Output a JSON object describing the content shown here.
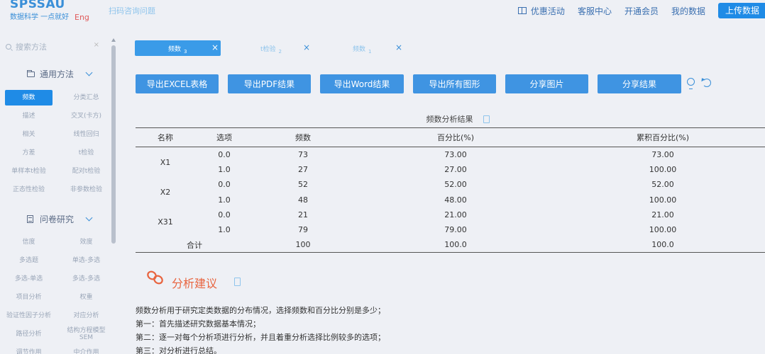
{
  "header": {
    "logo": "SPSSAU",
    "slogan": "数据科学 一点就好",
    "lang": "Eng",
    "scan_link": "扫码咨询问题",
    "nav": [
      "优惠活动",
      "客服中心",
      "开通会员",
      "我的数据"
    ],
    "upload_label": "上传数据"
  },
  "sidebar": {
    "search_placeholder": "搜索方法",
    "search_clear": "×",
    "group1": {
      "title": "通用方法",
      "items": [
        "频数",
        "分类汇总",
        "描述",
        "交叉(卡方)",
        "相关",
        "线性回归",
        "方差",
        "t检验",
        "单样本t检验",
        "配对t检验",
        "正态性检验",
        "非参数检验"
      ],
      "active": "频数"
    },
    "group2": {
      "title": "问卷研究",
      "items": [
        "信度",
        "效度",
        "多选题",
        "单选-多选",
        "多选-单选",
        "多选-多选",
        "项目分析",
        "权重",
        "验证性因子分析",
        "对应分析",
        "路径分析",
        "结构方程模型SEM",
        "调节作用",
        "中介作用"
      ]
    }
  },
  "tabs": [
    {
      "label": "频数",
      "sub": "3",
      "close": "×",
      "active": true
    },
    {
      "label": "t检验",
      "sub": "2",
      "close": "×",
      "active": false
    },
    {
      "label": "频数",
      "sub": "1",
      "close": "×",
      "active": false
    }
  ],
  "toolbar": {
    "buttons": [
      "导出EXCEL表格",
      "导出PDF结果",
      "导出Word结果",
      "导出所有图形",
      "分享图片",
      "分享结果"
    ]
  },
  "result_table": {
    "title": "频数分析结果",
    "headers": [
      "名称",
      "选项",
      "频数",
      "百分比(%)",
      "累积百分比(%)"
    ],
    "rows": [
      {
        "name": "X1",
        "option": "0.0",
        "freq": "73",
        "pct": "73.00",
        "cum": "73.00"
      },
      {
        "name": "",
        "option": "1.0",
        "freq": "27",
        "pct": "27.00",
        "cum": "100.00"
      },
      {
        "name": "X2",
        "option": "0.0",
        "freq": "52",
        "pct": "52.00",
        "cum": "52.00"
      },
      {
        "name": "",
        "option": "1.0",
        "freq": "48",
        "pct": "48.00",
        "cum": "100.00"
      },
      {
        "name": "X31",
        "option": "0.0",
        "freq": "21",
        "pct": "21.00",
        "cum": "21.00"
      },
      {
        "name": "",
        "option": "1.0",
        "freq": "79",
        "pct": "79.00",
        "cum": "100.00"
      }
    ],
    "total": {
      "label": "合计",
      "freq": "100",
      "pct": "100.0",
      "cum": "100.0"
    }
  },
  "analysis": {
    "title": "分析建议",
    "lines": [
      "频数分析用于研究定类数据的分布情况，选择频数和百分比分别是多少；",
      "第一：首先描述研究数据基本情况；",
      "第二：逐一对每个分析项进行分析，并且着重分析选择比例较多的选项；",
      "第三：对分析进行总结。"
    ]
  }
}
